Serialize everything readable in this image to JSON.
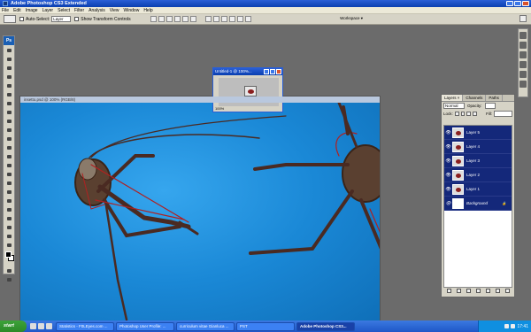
{
  "app": {
    "title": "Adobe Photoshop CS3 Extended"
  },
  "menu": {
    "items": [
      "File",
      "Edit",
      "Image",
      "Layer",
      "Select",
      "Filter",
      "Analysis",
      "View",
      "Window",
      "Help"
    ]
  },
  "options": {
    "auto_select_label": "Auto-Select:",
    "auto_select_value": "Layer",
    "transform_label": "Show Transform Controls",
    "workspace_label": "Workspace ▾"
  },
  "document": {
    "title": "insetto.psd @ 100% (RGB/8)"
  },
  "small_document": {
    "title": "Untitled-1 @ 100%...",
    "zoom": "100%"
  },
  "layers_panel": {
    "tabs": [
      "Layers ×",
      "Channels",
      "Paths"
    ],
    "blend_mode": "Normal",
    "opacity_label": "Opacity:",
    "lock_label": "Lock:",
    "fill_label": "Fill:",
    "layers": [
      {
        "name": "Layer 5"
      },
      {
        "name": "Layer 4"
      },
      {
        "name": "Layer 3"
      },
      {
        "name": "Layer 2"
      },
      {
        "name": "Layer 1"
      },
      {
        "name": "Background"
      }
    ]
  },
  "taskbar": {
    "start_label": "start",
    "tasks": [
      {
        "label": "Statistics - F0LEyes.com ..."
      },
      {
        "label": "Photoshop User Profile: ..."
      },
      {
        "label": "curriculum vitae Gianluca ..."
      },
      {
        "label": "PST"
      },
      {
        "label": "Adobe Photoshop CS3..."
      }
    ],
    "clock": "17:41"
  }
}
